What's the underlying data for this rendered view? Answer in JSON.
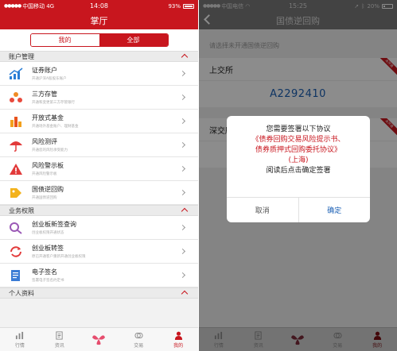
{
  "left": {
    "status": {
      "carrier": "中国移动",
      "network": "4G",
      "time": "14:08",
      "battery": "93%"
    },
    "title": "掌厅",
    "segments": [
      "我的",
      "全部"
    ],
    "sections": [
      {
        "title": "账户管理",
        "items": [
          {
            "title": "证券账户",
            "desc": "开通沪深A股股东账户",
            "icon": "stock-account-icon"
          },
          {
            "title": "三方存管",
            "desc": "开通和变更第三方存管银行",
            "icon": "third-party-deposit-icon"
          },
          {
            "title": "开放式基金",
            "desc": "开通场外基金账户、理财基金",
            "icon": "fund-icon"
          },
          {
            "title": "风险测评",
            "desc": "开通您的风险承受能力",
            "icon": "umbrella-icon"
          },
          {
            "title": "风险警示板",
            "desc": "开通风险警示板",
            "icon": "warning-icon"
          },
          {
            "title": "国债逆回购",
            "desc": "开通国债逆回购",
            "icon": "tag-icon"
          }
        ]
      },
      {
        "title": "业务权限",
        "items": [
          {
            "title": "创业板新签查询",
            "desc": "创业板权限开通状态",
            "icon": "search-icon"
          },
          {
            "title": "创业板转签",
            "desc": "原已开通客户重新开通创业板权限",
            "icon": "refresh-icon"
          },
          {
            "title": "电子签名",
            "desc": "签署电子签名约定书",
            "icon": "sign-icon"
          }
        ]
      },
      {
        "title": "个人资料",
        "items": []
      }
    ],
    "nav": [
      {
        "label": "行情",
        "icon": "chart-icon",
        "active": false
      },
      {
        "label": "资讯",
        "icon": "news-icon",
        "active": false
      },
      {
        "label": "",
        "icon": "logo-icon",
        "active": false
      },
      {
        "label": "交易",
        "icon": "trade-icon",
        "active": false
      },
      {
        "label": "我的",
        "icon": "user-icon",
        "active": true
      }
    ]
  },
  "right": {
    "status": {
      "carrier": "中国电信",
      "time": "15:25",
      "battery": "20%"
    },
    "title": "国债逆回购",
    "hint": "请选择未开通国债逆回购",
    "cards": [
      {
        "exchange": "上交所",
        "ribbon": "未开通",
        "code": "A2292410"
      },
      {
        "exchange": "深交所",
        "ribbon": "未开通",
        "code": ""
      }
    ],
    "dialog": {
      "line1": "您需要签署以下协议",
      "line2": "《债券回购交易风险提示书、",
      "line3": "债券质押式回购委托协议》",
      "line4": "(上海)",
      "line5": "阅读后点击确定签署",
      "cancel": "取消",
      "ok": "确定"
    },
    "nav": [
      {
        "label": "行情",
        "icon": "chart-icon",
        "active": false
      },
      {
        "label": "资讯",
        "icon": "news-icon",
        "active": false
      },
      {
        "label": "",
        "icon": "logo-icon",
        "active": false
      },
      {
        "label": "交易",
        "icon": "trade-icon",
        "active": false
      },
      {
        "label": "我的",
        "icon": "user-icon",
        "active": true
      }
    ]
  },
  "colors": {
    "brand_red": "#c8161e",
    "link_blue": "#1a5fb4"
  }
}
